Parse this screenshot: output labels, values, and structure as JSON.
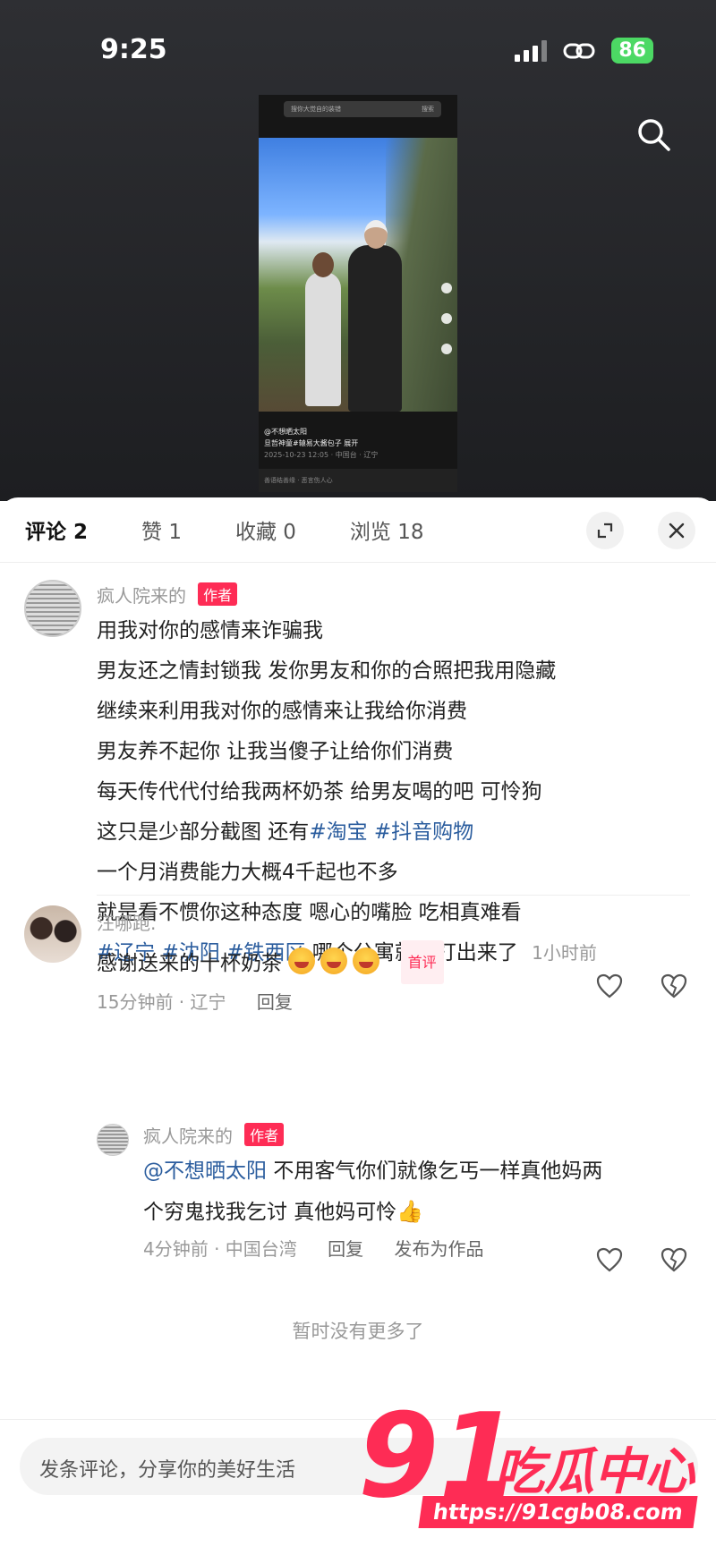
{
  "status_bar": {
    "time": "9:25",
    "battery": "86"
  },
  "preview": {
    "search_placeholder": "搜你大觉自的装错",
    "search_button": "搜索",
    "author": "@不想晒太阳",
    "caption": "旦哲神童#辕易大酱包子  展开",
    "date_loc": "2025-10-23 12:05 · 中国台 · 辽宁",
    "comment_hint": "善语结善缘 · 恶言伤人心"
  },
  "tabs": [
    {
      "label": "评论 2"
    },
    {
      "label": "赞 1"
    },
    {
      "label": "收藏 0"
    },
    {
      "label": "浏览 18"
    }
  ],
  "comments": {
    "c1": {
      "name": "疯人院来的",
      "badge": "作者",
      "lines": [
        "用我对你的感情来诈骗我",
        "男友还之情封锁我 发你男友和你的合照把我用隐藏",
        "继续来利用我对你的感情来让我给你消费",
        "男友养不起你 让我当傻子让给你们消费",
        "每天传代代付给我两杯奶茶 给男友喝的吧 可怜狗"
      ],
      "line6_pre": "这只是少部分截图 还有",
      "tag_taobao": "#淘宝",
      "tag_douyin": "#抖音购物",
      "line7": "一个月消费能力大概4千起也不多",
      "line8": "就是看不惯你这种态度 嗯心的嘴脸 吃相真难看",
      "tag_liaoning": "#辽宁",
      "tag_shenyang": "#沈阳",
      "tag_tiexi": "#铁西区",
      "line9_post": "哪个公寓就不打出来了",
      "time": "1小时前"
    },
    "c2": {
      "name": "汪哪跑.",
      "text": "感谢送来的十杯奶茶",
      "first_badge": "首评",
      "time_loc": "15分钟前 · 辽宁",
      "reply": "回复"
    },
    "c3": {
      "name": "疯人院来的",
      "badge": "作者",
      "mention": "@不想晒太阳",
      "line1_post": "不用客气你们就像乞丐一样真他妈两",
      "line2": "个穷鬼找我乞讨 真他妈可怜",
      "time_loc": "4分钟前 · 中国台湾",
      "reply": "回复",
      "publish": "发布为作品"
    }
  },
  "no_more": "暂时没有更多了",
  "input_placeholder": "发条评论，分享你的美好生活",
  "watermark": {
    "logo": "91",
    "text": "吃瓜中心",
    "url": "https://91cgb08.com"
  },
  "icons": [
    "search-icon",
    "expand-icon",
    "close-icon",
    "heart-icon",
    "dislike-icon"
  ]
}
